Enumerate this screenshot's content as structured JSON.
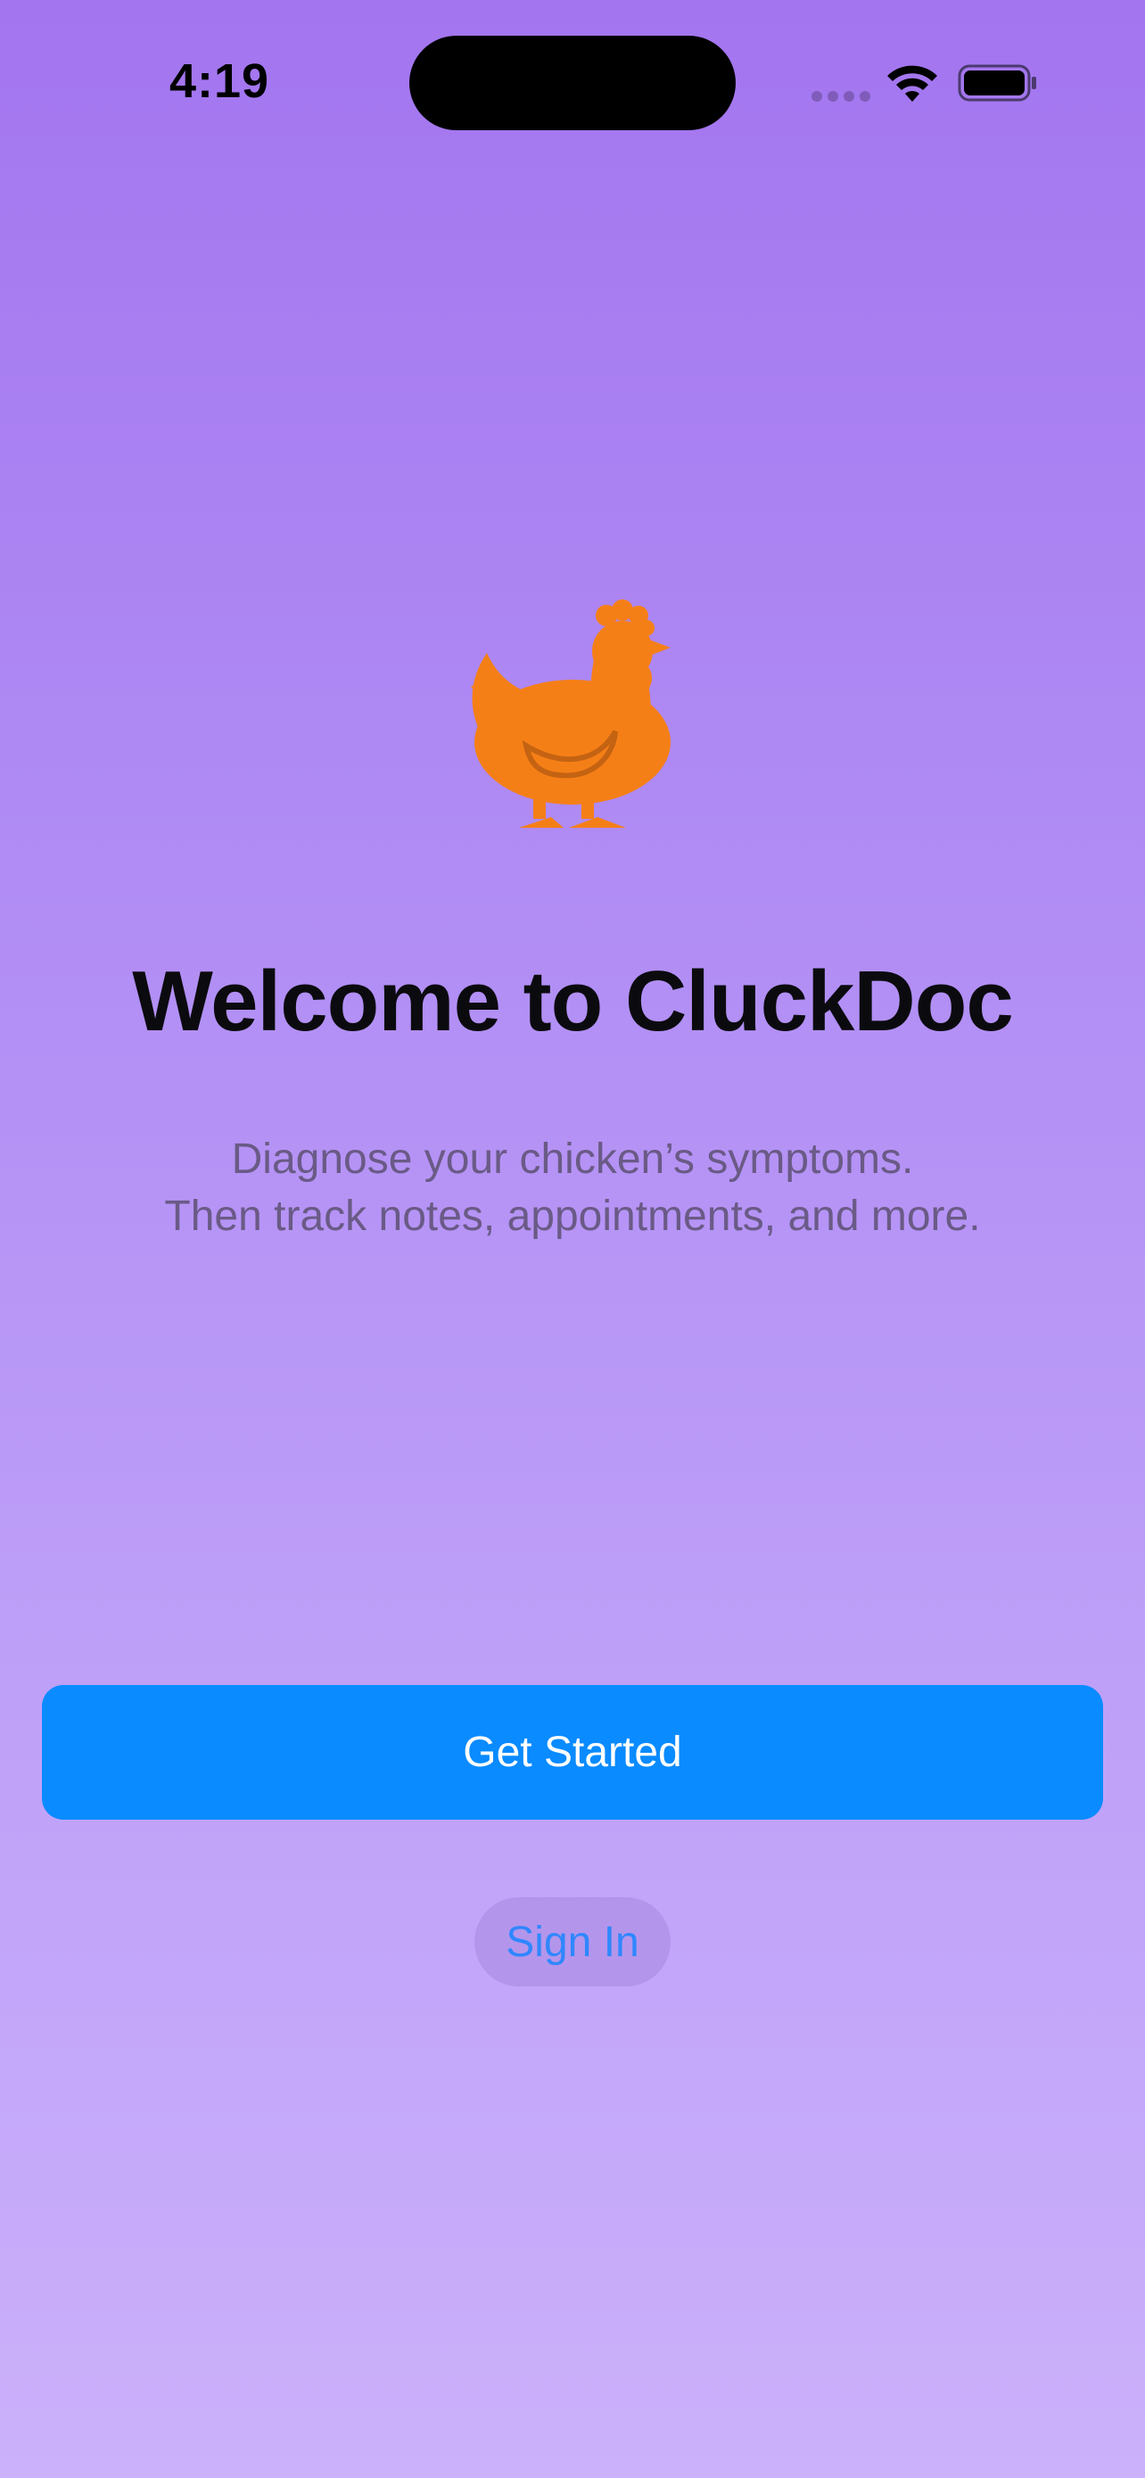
{
  "status_bar": {
    "time": "4:19",
    "icons": [
      "cellular-signal-icon",
      "wifi-icon",
      "battery-icon"
    ]
  },
  "hero": {
    "icon": "chicken-icon",
    "icon_color": "#f57f17"
  },
  "welcome": {
    "title": "Welcome to CluckDoc",
    "subtitle_line1": "Diagnose your chicken’s symptoms.",
    "subtitle_line2": "Then track notes, appointments, and more."
  },
  "actions": {
    "get_started_label": "Get Started",
    "sign_in_label": "Sign In"
  },
  "colors": {
    "background_top": "#a375ef",
    "background_bottom": "#cbb0fb",
    "primary_button": "#0a8bff",
    "link": "#2f87ff"
  }
}
